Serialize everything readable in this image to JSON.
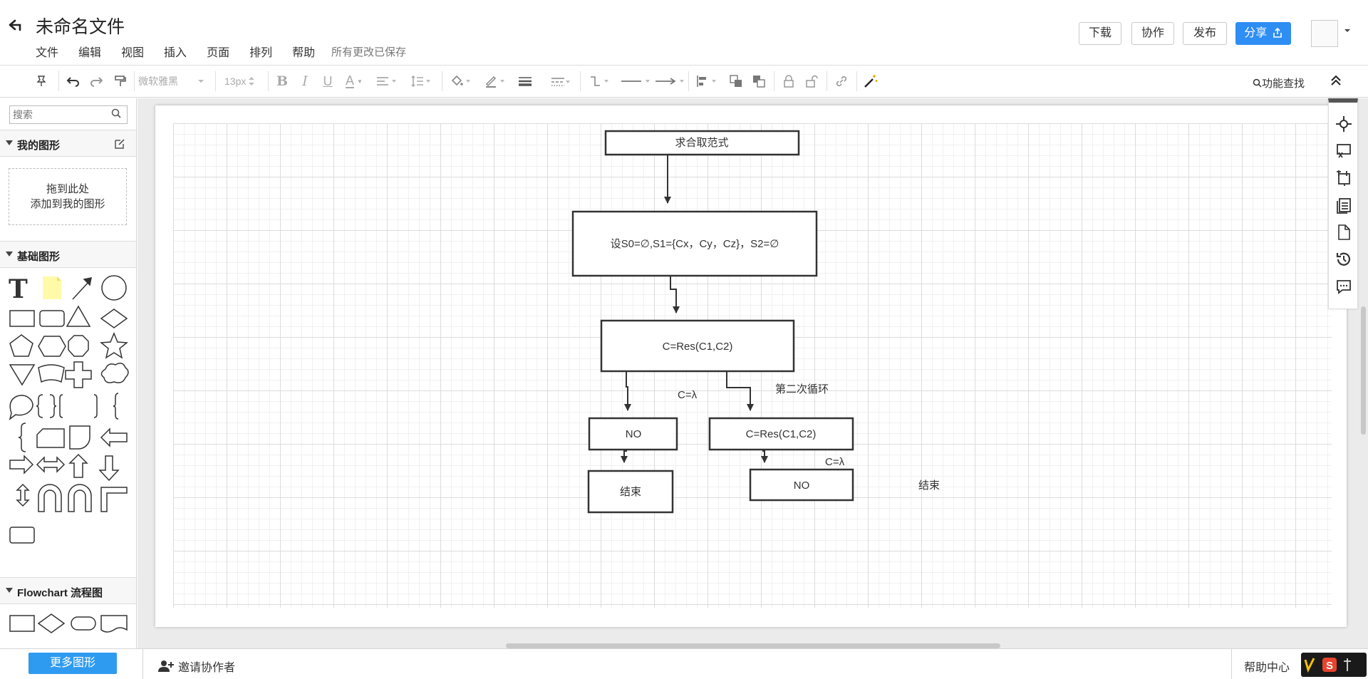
{
  "header": {
    "title": "未命名文件",
    "menus": [
      "文件",
      "编辑",
      "视图",
      "插入",
      "页面",
      "排列",
      "帮助"
    ],
    "save_status": "所有更改已保存",
    "buttons": {
      "download": "下载",
      "collaborate": "协作",
      "publish": "发布",
      "share": "分享"
    }
  },
  "toolbar": {
    "font_family": "微软雅黑",
    "font_size": "13px",
    "feature_search": "功能查找"
  },
  "left_panel": {
    "search_placeholder": "搜索",
    "my_shapes_title": "我的图形",
    "drop_hint_line1": "拖到此处",
    "drop_hint_line2": "添加到我的图形",
    "basic_shapes_title": "基础图形",
    "flowchart_title": "Flowchart 流程图",
    "more_shapes": "更多图形"
  },
  "bottom_bar": {
    "invite": "邀请协作者",
    "help_center": "帮助中心"
  },
  "diagram": {
    "nodes": {
      "start": "求合取范式",
      "init": "设S0=∅,S1={Cx，Cy，Cz}，S2=∅",
      "res1": "C=Res(C1,C2)",
      "no1": "NO",
      "end1": "结束",
      "res2": "C=Res(C1,C2)",
      "no2": "NO",
      "end2": "结束"
    },
    "edge_labels": {
      "lambda1": "C=λ",
      "second_loop": "第二次循环",
      "lambda2": "C=λ"
    }
  },
  "colors": {
    "accent": "#2f8ef4",
    "more_shapes_button": "#2f9bf0",
    "canvas_bg": "#ebebeb"
  }
}
